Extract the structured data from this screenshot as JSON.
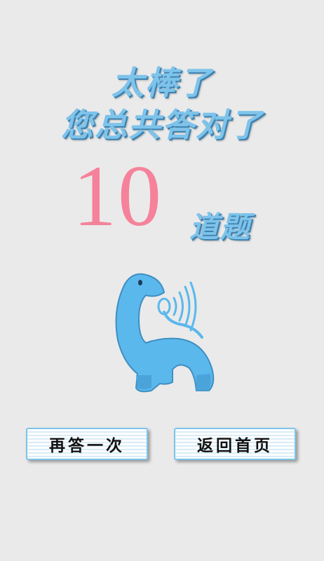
{
  "result": {
    "line1": "太棒了",
    "line2": "您总共答对了",
    "count": "10",
    "unit": "道题"
  },
  "buttons": {
    "retry_label": "再答一次",
    "home_label": "返回首页"
  },
  "colors": {
    "background": "#eaeaea",
    "title_blue": "#7ec3ea",
    "title_shadow": "#3e82b0",
    "count_pink": "#f5829a",
    "mascot_blue": "#5bb8ec"
  },
  "icons": {
    "mascot": "dinosaur-mascot-icon"
  }
}
